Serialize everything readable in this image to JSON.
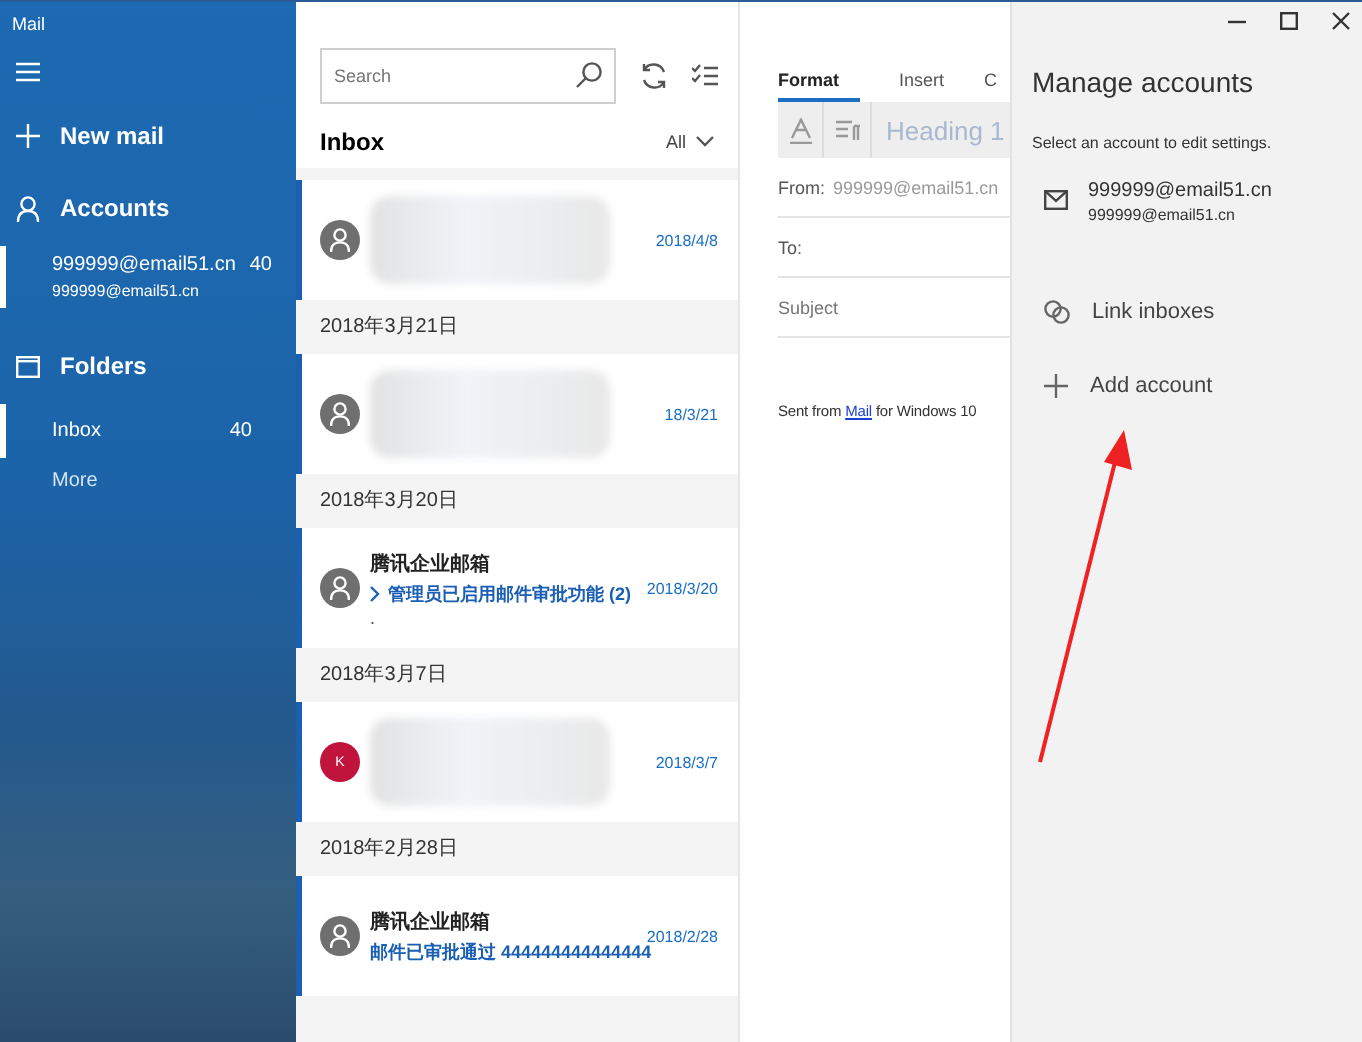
{
  "window": {
    "title": "Mail"
  },
  "sidebar": {
    "new_mail": "New mail",
    "accounts_heading": "Accounts",
    "accounts": [
      {
        "name": "999999@email51.cn",
        "email": "999999@email51.cn",
        "count": "40",
        "selected": true
      }
    ],
    "folders_heading": "Folders",
    "folders": [
      {
        "name": "Inbox",
        "count": "40",
        "selected": true
      }
    ],
    "more": "More"
  },
  "message_list": {
    "search": {
      "placeholder": "Search"
    },
    "title": "Inbox",
    "filter": "All",
    "items": [
      {
        "kind": "message",
        "avatar": {
          "kind": "person"
        },
        "redacted": true,
        "date": "2018/4/8",
        "unread": true
      },
      {
        "kind": "header",
        "label": "2018年3月21日"
      },
      {
        "kind": "message",
        "avatar": {
          "kind": "person"
        },
        "redacted": true,
        "date": "18/3/21",
        "unread": true
      },
      {
        "kind": "header",
        "label": "2018年3月20日"
      },
      {
        "kind": "message",
        "avatar": {
          "kind": "person"
        },
        "sender": "腾讯企业邮箱",
        "subject": "管理员已启用邮件审批功能 (2)",
        "thread": true,
        "preview": ".",
        "date": "2018/3/20",
        "unread": true
      },
      {
        "kind": "header",
        "label": "2018年3月7日"
      },
      {
        "kind": "message",
        "avatar": {
          "kind": "initial",
          "initial": "K",
          "color": "#c1143c"
        },
        "redacted": true,
        "date": "2018/3/7",
        "unread": true
      },
      {
        "kind": "header",
        "label": "2018年2月28日"
      },
      {
        "kind": "message",
        "avatar": {
          "kind": "person"
        },
        "sender": "腾讯企业邮箱",
        "subject": "邮件已审批通过 444444444444444",
        "thread": false,
        "date": "2018/2/28",
        "unread": true
      }
    ]
  },
  "compose": {
    "tabs": [
      {
        "label": "Format",
        "selected": true
      },
      {
        "label": "Insert",
        "selected": false
      },
      {
        "label": "C",
        "selected": false
      }
    ],
    "style": "Heading 1",
    "from_label": "From:",
    "from_value": "999999@email51.cn",
    "to_label": "To:",
    "subject": {
      "placeholder": "Subject"
    },
    "signature": {
      "before": "Sent from",
      "link": "Mail",
      "after": "for Windows 10"
    }
  },
  "panel": {
    "title": "Manage accounts",
    "hint": "Select an account to edit settings.",
    "accounts": [
      {
        "name": "999999@email51.cn",
        "email": "999999@email51.cn"
      }
    ],
    "actions": [
      {
        "kind": "link",
        "label": "Link inboxes"
      },
      {
        "kind": "add",
        "label": "Add account"
      }
    ]
  }
}
